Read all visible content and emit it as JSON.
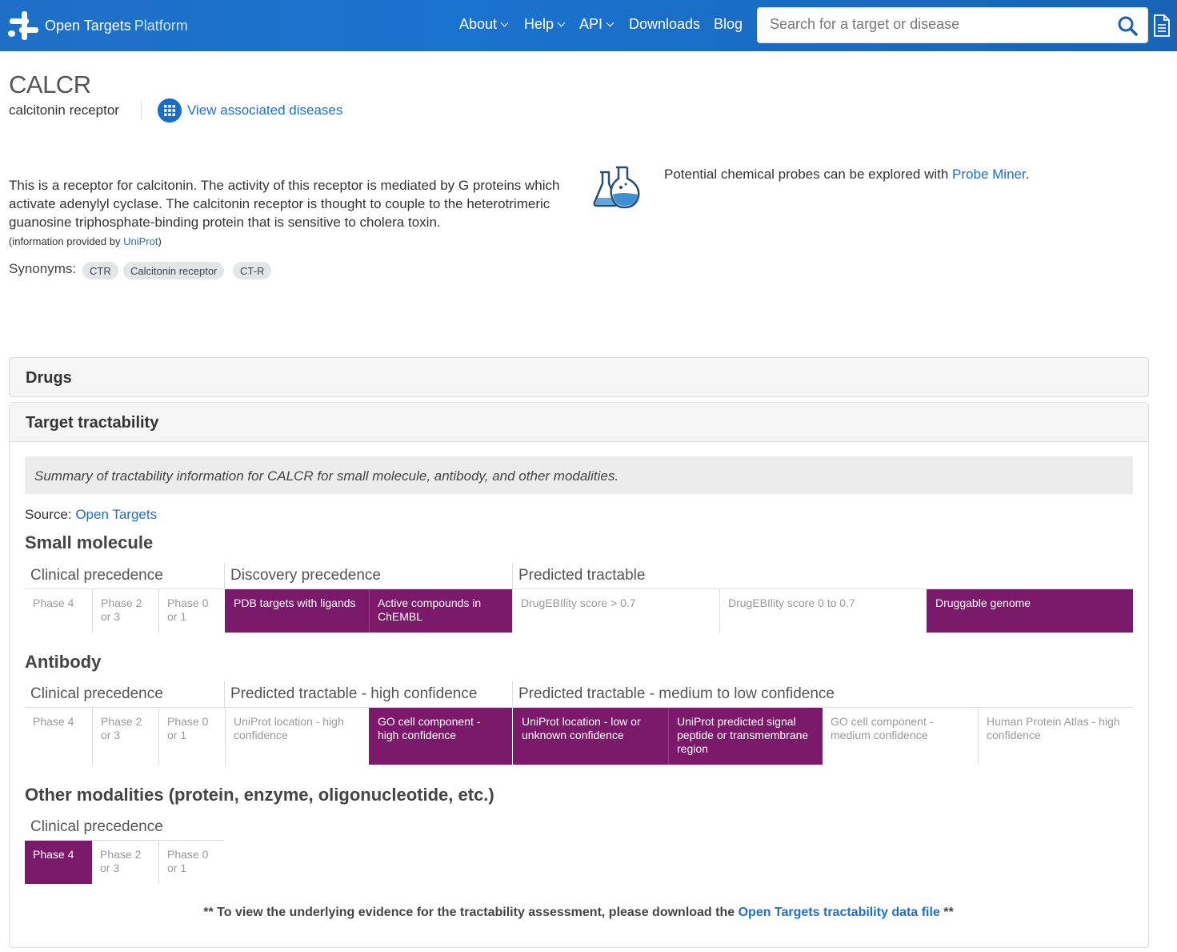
{
  "header": {
    "brand_name": "Open Targets",
    "brand_suffix": "Platform",
    "nav": [
      "About",
      "Help",
      "API",
      "Downloads",
      "Blog"
    ],
    "search_placeholder": "Search for a target or disease",
    "accent_color": "#1a6cc8"
  },
  "target": {
    "symbol": "CALCR",
    "name": "calcitonin receptor",
    "view_associated": "View associated diseases",
    "description": "This is a receptor for calcitonin. The activity of this receptor is mediated by G proteins which activate adenylyl cyclase. The calcitonin receptor is thought to couple to the heterotrimeric guanosine triphosphate-binding protein that is sensitive to cholera toxin.",
    "info_prefix": "(information provided by ",
    "info_link": "UniProt",
    "info_suffix": ")",
    "synonyms_label": "Synonyms:",
    "synonyms": [
      "CTR",
      "Calcitonin receptor",
      "CT-R"
    ],
    "probe_prefix": "Potential chemical probes can be explored with ",
    "probe_link": "Probe Miner",
    "probe_suffix": "."
  },
  "sections": {
    "drugs": "Drugs",
    "tractability": "Target tractability"
  },
  "tractability": {
    "summary": "Summary of tractability information for CALCR for small molecule, antibody, and other modalities.",
    "source_label": "Source:",
    "source_link": "Open Targets",
    "highlight_color": "#7b1a6a",
    "small_molecule": {
      "title": "Small molecule",
      "groups": [
        "Clinical precedence",
        "Discovery precedence",
        "Predicted tractable"
      ],
      "cells": [
        {
          "label": "Phase 4",
          "on": false
        },
        {
          "label": "Phase 2 or 3",
          "on": false
        },
        {
          "label": "Phase 0 or 1",
          "on": false
        },
        {
          "label": "PDB targets with ligands",
          "on": true
        },
        {
          "label": "Active compounds in ChEMBL",
          "on": true
        },
        {
          "label": "DrugEBIlity score > 0.7",
          "on": false
        },
        {
          "label": "DrugEBIlity score 0 to 0.7",
          "on": false
        },
        {
          "label": "Druggable genome",
          "on": true
        }
      ]
    },
    "antibody": {
      "title": "Antibody",
      "groups": [
        "Clinical precedence",
        "Predicted tractable - high confidence",
        "Predicted tractable - medium to low confidence"
      ],
      "cells": [
        {
          "label": "Phase 4",
          "on": false
        },
        {
          "label": "Phase 2 or 3",
          "on": false
        },
        {
          "label": "Phase 0 or 1",
          "on": false
        },
        {
          "label": "UniProt location - high confidence",
          "on": false
        },
        {
          "label": "GO cell component - high confidence",
          "on": true
        },
        {
          "label": "UniProt location - low or unknown confidence",
          "on": true
        },
        {
          "label": "UniProt predicted signal peptide or transmembrane region",
          "on": true
        },
        {
          "label": "GO cell component - medium confidence",
          "on": false
        },
        {
          "label": "Human Protein Atlas - high confidence",
          "on": false
        }
      ]
    },
    "other": {
      "title": "Other modalities (protein, enzyme, oligonucleotide, etc.)",
      "groups": [
        "Clinical precedence"
      ],
      "cells": [
        {
          "label": "Phase 4",
          "on": true
        },
        {
          "label": "Phase 2 or 3",
          "on": false
        },
        {
          "label": "Phase 0 or 1",
          "on": false
        }
      ]
    },
    "footer_prefix": "** To view the underlying evidence for the tractability assessment, please download the ",
    "footer_link": "Open Targets tractability data file",
    "footer_suffix": " **"
  }
}
